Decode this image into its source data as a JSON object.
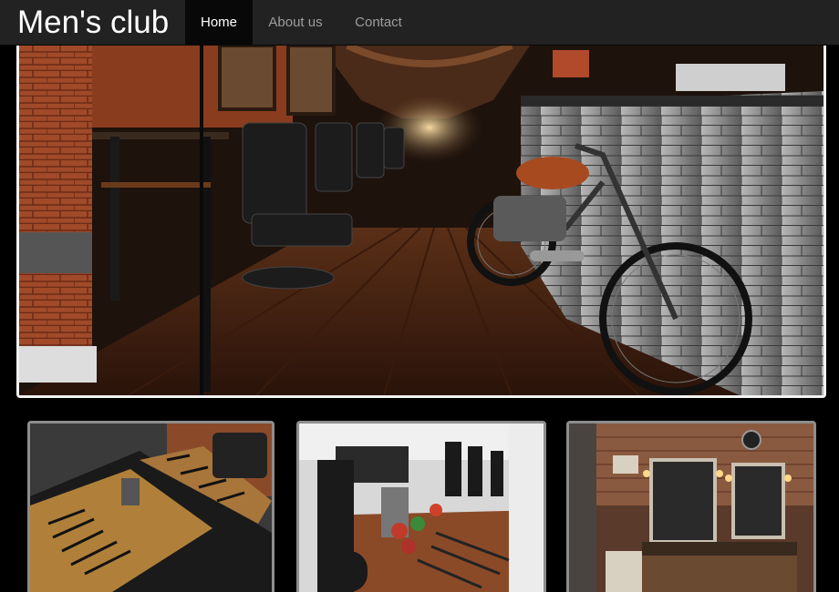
{
  "header": {
    "brand": "Men's club",
    "nav": [
      {
        "label": "Home",
        "active": true
      },
      {
        "label": "About us",
        "active": false
      },
      {
        "label": "Contact",
        "active": false
      }
    ]
  },
  "hero": {
    "subject": "barbershop-interior-with-motorcycle"
  },
  "gallery": [
    {
      "subject": "barber-tools-table"
    },
    {
      "subject": "grooming-products-counter"
    },
    {
      "subject": "loft-barbershop-mirrors"
    }
  ],
  "colors": {
    "navbar": "#222222",
    "active_nav": "#080808",
    "nav_text": "#9d9d9d",
    "page_background": "#000000"
  }
}
